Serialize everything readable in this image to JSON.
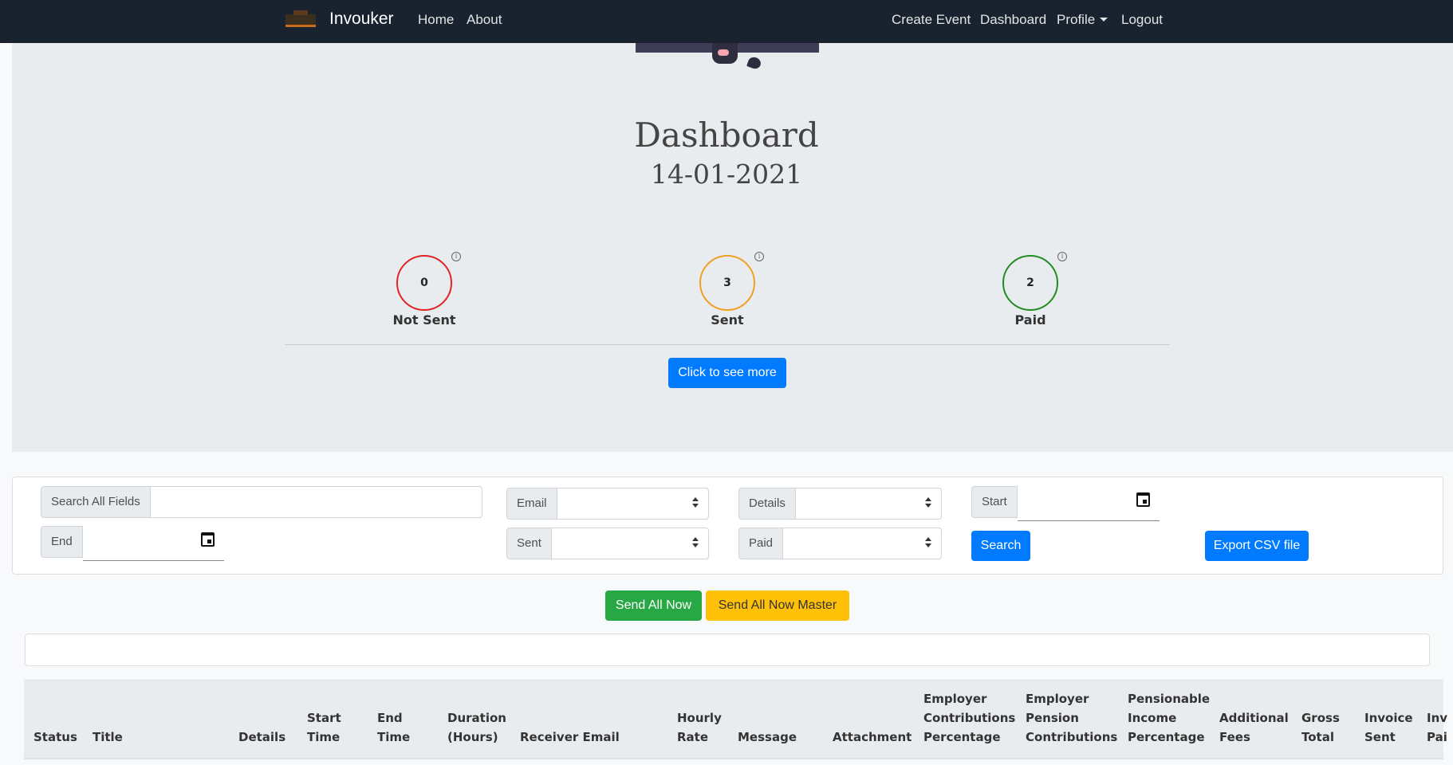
{
  "nav": {
    "brand": "Invouker",
    "home": "Home",
    "about": "About",
    "create_event": "Create Event",
    "dashboard": "Dashboard",
    "profile": "Profile",
    "logout": "Logout"
  },
  "hero": {
    "title": "Dashboard",
    "date": "14-01-2021"
  },
  "stats": {
    "not_sent": {
      "value": "0",
      "label": "Not Sent",
      "color": "#e02424"
    },
    "sent": {
      "value": "3",
      "label": "Sent",
      "color": "#f0a020"
    },
    "paid": {
      "value": "2",
      "label": "Paid",
      "color": "#218c21"
    },
    "info_glyph": "i"
  },
  "see_more_label": "Click to see more",
  "filters": {
    "search_all": "Search All Fields",
    "email": "Email",
    "details": "Details",
    "start": "Start",
    "end": "End",
    "sent": "Sent",
    "paid": "Paid",
    "search_button": "Search",
    "export_button": "Export CSV file"
  },
  "actions": {
    "send_all_now": "Send All Now",
    "send_all_now_master": "Send All Now Master"
  },
  "table": {
    "columns": [
      [
        "Status"
      ],
      [
        "Title"
      ],
      [
        "Details"
      ],
      [
        "Start",
        "Time"
      ],
      [
        "End",
        "Time"
      ],
      [
        "Duration",
        "(Hours)"
      ],
      [
        "Receiver Email"
      ],
      [
        "Hourly",
        "Rate"
      ],
      [
        "Message"
      ],
      [
        "Attachment"
      ],
      [
        "Employer",
        "Contributions",
        "Percentage"
      ],
      [
        "Employer",
        "Pension",
        "Contributions"
      ],
      [
        "Pensionable",
        "Income",
        "Percentage"
      ],
      [
        "Additional",
        "Fees"
      ],
      [
        "Gross",
        "Total"
      ],
      [
        "Invoice",
        "Sent"
      ],
      [
        "Inv",
        "Pai"
      ]
    ]
  }
}
